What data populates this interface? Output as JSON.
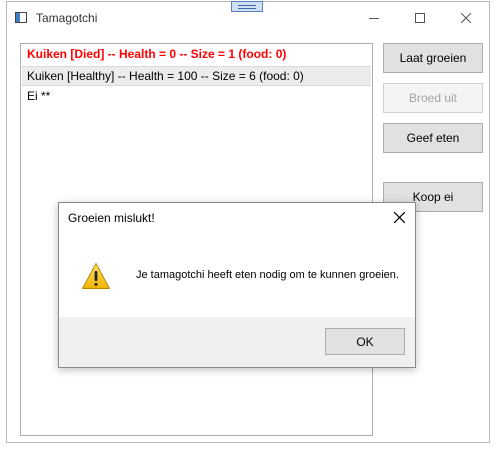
{
  "window": {
    "title": "Tamagotchi",
    "caption_buttons": {
      "minimize": "—",
      "maximize": "☐",
      "close": "✕"
    }
  },
  "list": {
    "items": [
      {
        "text": "Kuiken [Died] -- Health = 0 -- Size = 1 (food: 0)",
        "status": "died",
        "color": "#ff0000"
      },
      {
        "text": "Kuiken [Healthy] -- Health = 100 -- Size = 6 (food: 0)",
        "status": "selected"
      },
      {
        "text": "Ei **",
        "status": "normal"
      }
    ]
  },
  "buttons": {
    "grow": "Laat groeien",
    "hatch": "Broed uit",
    "feed": "Geef eten",
    "buy": "Koop ei"
  },
  "dialog": {
    "title": "Groeien mislukt!",
    "message": "Je tamagotchi heeft eten nodig om te kunnen groeien.",
    "ok": "OK",
    "icon": "warning-icon"
  }
}
